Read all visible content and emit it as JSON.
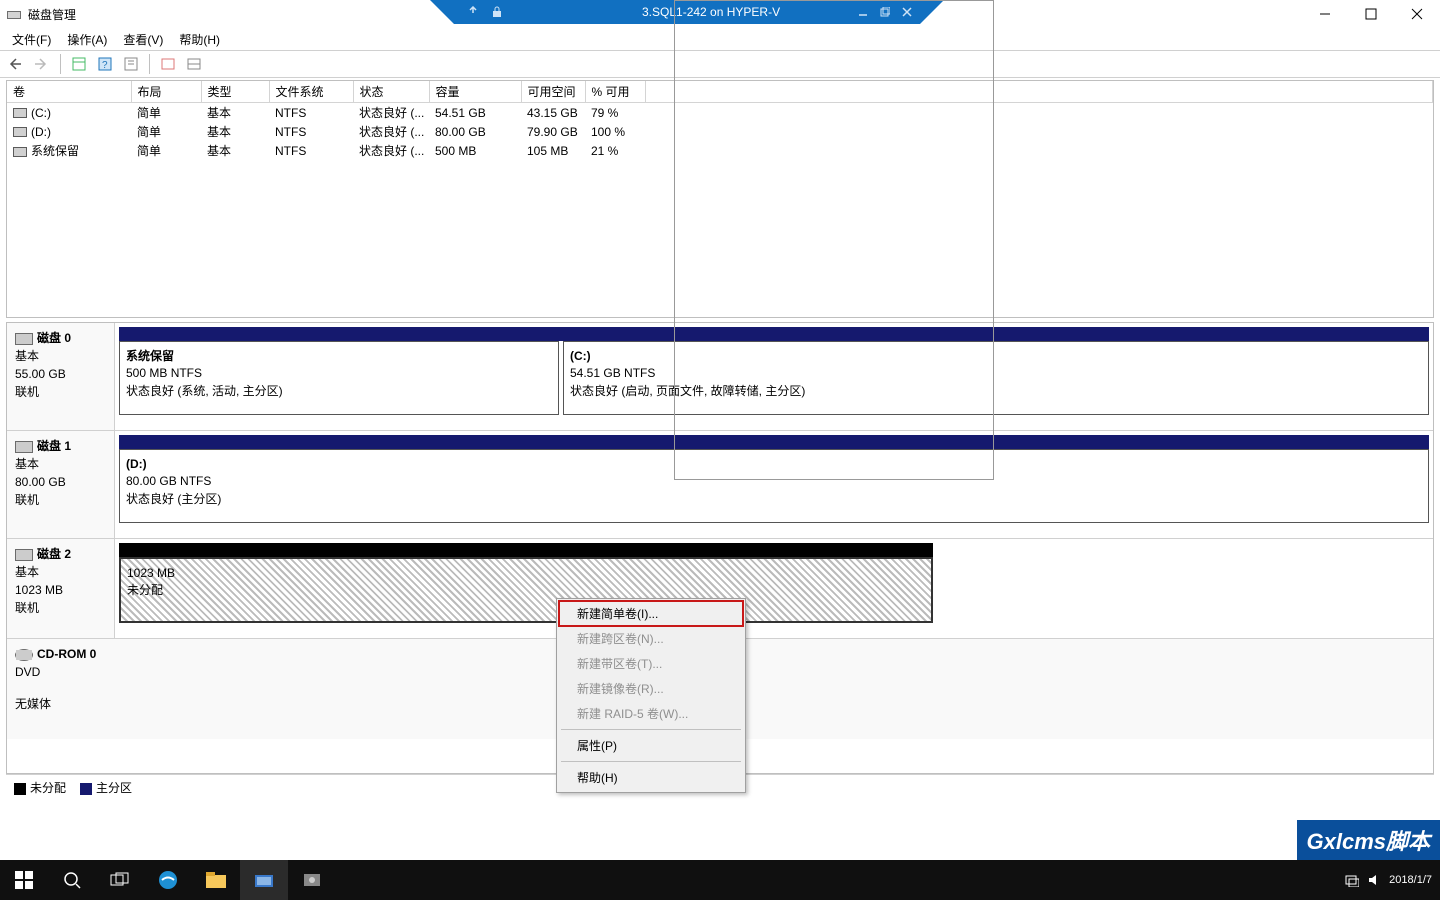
{
  "title": "磁盘管理",
  "vm_title": "3.SQL1-242 on HYPER-V",
  "menu": {
    "file": "文件(F)",
    "action": "操作(A)",
    "view": "查看(V)",
    "help": "帮助(H)"
  },
  "table": {
    "headers": {
      "vol": "卷",
      "layout": "布局",
      "type": "类型",
      "fs": "文件系统",
      "status": "状态",
      "capacity": "容量",
      "free": "可用空间",
      "pct": "% 可用"
    },
    "rows": [
      {
        "vol": "(C:)",
        "layout": "简单",
        "type": "基本",
        "fs": "NTFS",
        "status": "状态良好 (...",
        "capacity": "54.51 GB",
        "free": "43.15 GB",
        "pct": "79 %"
      },
      {
        "vol": "(D:)",
        "layout": "简单",
        "type": "基本",
        "fs": "NTFS",
        "status": "状态良好 (...",
        "capacity": "80.00 GB",
        "free": "79.90 GB",
        "pct": "100 %"
      },
      {
        "vol": "系统保留",
        "layout": "简单",
        "type": "基本",
        "fs": "NTFS",
        "status": "状态良好 (...",
        "capacity": "500 MB",
        "free": "105 MB",
        "pct": "21 %"
      }
    ]
  },
  "disks": {
    "d0": {
      "name": "磁盘 0",
      "type": "基本",
      "size": "55.00 GB",
      "status": "联机",
      "p0": {
        "title": "系统保留",
        "line2": "500 MB NTFS",
        "line3": "状态良好 (系统, 活动, 主分区)"
      },
      "p1": {
        "title": "(C:)",
        "line2": "54.51 GB NTFS",
        "line3": "状态良好 (启动, 页面文件, 故障转储, 主分区)"
      }
    },
    "d1": {
      "name": "磁盘 1",
      "type": "基本",
      "size": "80.00 GB",
      "status": "联机",
      "p0": {
        "title": "(D:)",
        "line2": "80.00 GB NTFS",
        "line3": "状态良好 (主分区)"
      }
    },
    "d2": {
      "name": "磁盘 2",
      "type": "基本",
      "size": "1023 MB",
      "status": "联机",
      "p0": {
        "line2": "1023 MB",
        "line3": "未分配"
      }
    },
    "cd": {
      "name": "CD-ROM 0",
      "type": "DVD",
      "status": "无媒体"
    }
  },
  "legend": {
    "unalloc": "未分配",
    "primary": "主分区"
  },
  "ctx": {
    "simple": "新建简单卷(I)...",
    "spanned": "新建跨区卷(N)...",
    "striped": "新建带区卷(T)...",
    "mirror": "新建镜像卷(R)...",
    "raid5": "新建 RAID-5 卷(W)...",
    "props": "属性(P)",
    "help": "帮助(H)"
  },
  "tray": {
    "date": "2018/1/7"
  },
  "watermark": "Gxlcms脚本"
}
